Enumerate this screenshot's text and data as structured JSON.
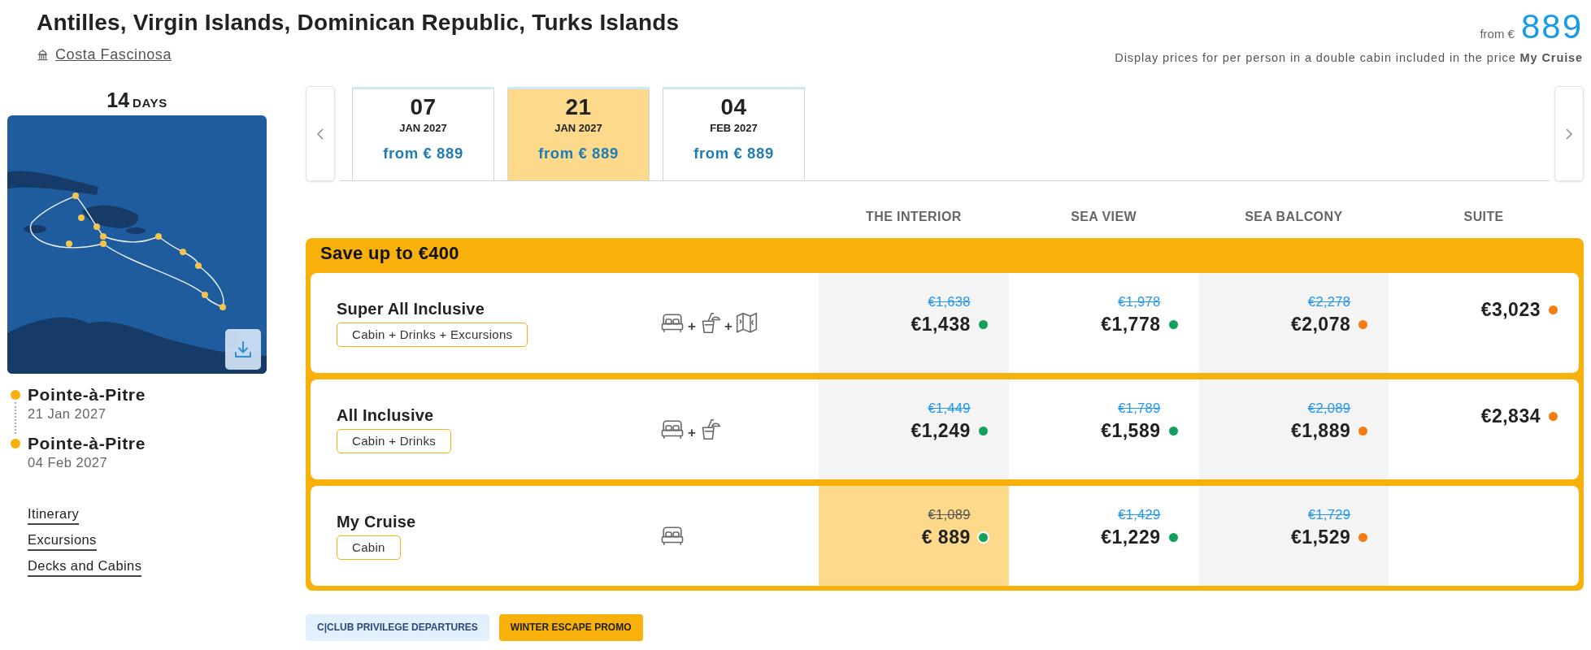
{
  "header": {
    "title": "Antilles, Virgin Islands, Dominican Republic, Turks Islands",
    "ship": "Costa Fascinosa",
    "price_prefix": "from €",
    "price": "889",
    "note": "Display prices for per person in a double cabin included in the price **My Cruise**"
  },
  "itinerary": {
    "duration": {
      "number": "14",
      "unit": "DAYS"
    },
    "stops": [
      {
        "port": "Pointe-à-Pitre",
        "date": "21 Jan 2027"
      },
      {
        "port": "Pointe-à-Pitre",
        "date": "04 Feb 2027"
      }
    ],
    "links": [
      "Itinerary",
      "Excursions",
      "Decks and Cabins"
    ]
  },
  "departures": [
    {
      "day": "07",
      "month": "JAN 2027",
      "price": "from € 889",
      "selected": false
    },
    {
      "day": "21",
      "month": "JAN 2027",
      "price": "from € 889",
      "selected": true
    },
    {
      "day": "04",
      "month": "FEB 2027",
      "price": "from € 889",
      "selected": false
    }
  ],
  "cabin_columns": [
    "THE INTERIOR",
    "SEA VIEW",
    "SEA BALCONY",
    "SUITE"
  ],
  "offer": {
    "banner": "Save up to €400",
    "packages": [
      {
        "name": "Super All Inclusive",
        "includes": "Cabin + Drinks + Excursions",
        "features": [
          {
            "kind": "bed"
          },
          {
            "kind": "drink",
            "joiner": "+"
          },
          {
            "kind": "map",
            "joiner": "+"
          }
        ],
        "prices": [
          {
            "old": "€1,638",
            "price": "€1,438",
            "color": "#12a15c",
            "selected": false
          },
          {
            "old": "€1,978",
            "price": "€1,778",
            "color": "#12a15c",
            "selected": false
          },
          {
            "old": "€2,278",
            "price": "€2,078",
            "color": "#f57c13",
            "selected": false
          },
          {
            "price": "€3,023",
            "color": "#f57c13",
            "selected": false
          }
        ]
      },
      {
        "name": "All Inclusive",
        "includes": "Cabin + Drinks",
        "features": [
          {
            "kind": "bed"
          },
          {
            "kind": "drink",
            "joiner": "+"
          }
        ],
        "prices": [
          {
            "old": "€1,449",
            "price": "€1,249",
            "color": "#12a15c",
            "selected": false
          },
          {
            "old": "€1,789",
            "price": "€1,589",
            "color": "#12a15c",
            "selected": false
          },
          {
            "old": "€2,089",
            "price": "€1,889",
            "color": "#f57c13",
            "selected": false
          },
          {
            "price": "€2,834",
            "color": "#f57c13",
            "selected": false
          }
        ]
      },
      {
        "name": "My Cruise",
        "includes": "Cabin",
        "features": [
          {
            "kind": "bed"
          }
        ],
        "prices": [
          {
            "old": "€1,089",
            "price": "€ 889",
            "color": "#12a15c",
            "selected": true
          },
          {
            "old": "€1,429",
            "price": "€1,229",
            "color": "#12a15c",
            "selected": false
          },
          {
            "old": "€1,729",
            "price": "€1,529",
            "color": "#f57c13",
            "selected": false
          }
        ]
      }
    ]
  },
  "tags": [
    {
      "label": "C|CLUB PRIVILEGE DEPARTURES",
      "kind": "info"
    },
    {
      "label": "WINTER ESCAPE PROMO",
      "kind": "promo"
    }
  ]
}
